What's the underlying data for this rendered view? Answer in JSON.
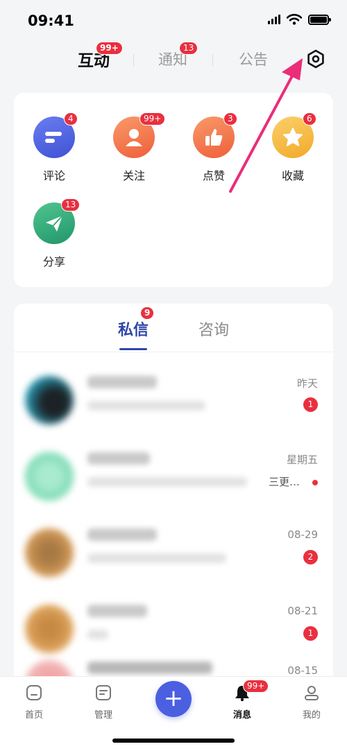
{
  "status_bar": {
    "time": "09:41"
  },
  "top_tabs": {
    "items": [
      {
        "label": "互动",
        "badge": "99+"
      },
      {
        "label": "通知",
        "badge": "13"
      },
      {
        "label": "公告"
      }
    ],
    "active": "互动"
  },
  "interactions": [
    {
      "label": "评论",
      "badge": "4",
      "color": "#4a5fe0",
      "icon": "comment-icon"
    },
    {
      "label": "关注",
      "badge": "99+",
      "color": "#f4754a",
      "icon": "person-icon"
    },
    {
      "label": "点赞",
      "badge": "3",
      "color": "#f4754a",
      "icon": "thumbs-up-icon"
    },
    {
      "label": "收藏",
      "badge": "6",
      "color": "#f6b43a",
      "icon": "star-icon"
    },
    {
      "label": "分享",
      "badge": "13",
      "color": "#2fae7a",
      "icon": "paper-plane-icon"
    }
  ],
  "messages": {
    "tabs": [
      {
        "label": "私信",
        "badge": "9"
      },
      {
        "label": "咨询"
      }
    ],
    "active_tab": "私信",
    "rows": [
      {
        "time": "昨天",
        "badge": "1"
      },
      {
        "time": "星期五",
        "snippet": "三更…",
        "dot": true
      },
      {
        "time": "08-29",
        "badge": "2"
      },
      {
        "time": "08-21",
        "badge": "1"
      },
      {
        "time": "08-15"
      }
    ]
  },
  "bottom_nav": {
    "items": [
      {
        "label": "首页"
      },
      {
        "label": "管理"
      },
      {
        "label": "消息",
        "badge": "99+"
      },
      {
        "label": "我的"
      }
    ],
    "active": "消息"
  },
  "colors": {
    "accent": "#2f46a8",
    "badge": "#e8303f",
    "plus_button": "#4a60e0",
    "annotation_arrow": "#ea2d78"
  }
}
